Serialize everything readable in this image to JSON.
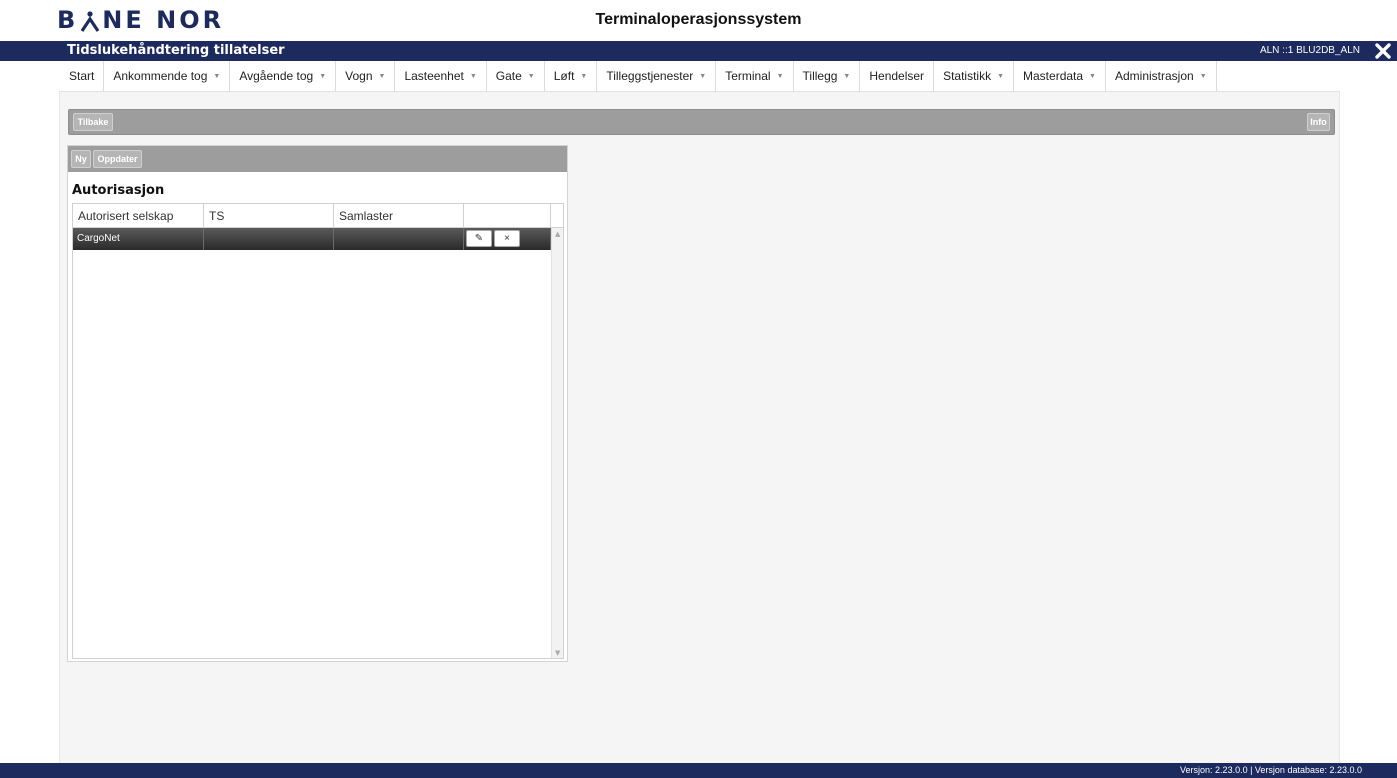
{
  "brand": {
    "logo_text_left": "B",
    "logo_text_right": "NE NOR",
    "logo_color": "#1c2a5e"
  },
  "app_title": "Terminaloperasjonssystem",
  "titlebar": {
    "title": "Tidslukehåndtering tillatelser",
    "user": "ALN ::1 BLU2DB_ALN",
    "close_icon": "close-icon"
  },
  "nav": {
    "items": [
      {
        "label": "Start",
        "dropdown": false
      },
      {
        "label": "Ankommende tog",
        "dropdown": true
      },
      {
        "label": "Avgående tog",
        "dropdown": true
      },
      {
        "label": "Vogn",
        "dropdown": true
      },
      {
        "label": "Lasteenhet",
        "dropdown": true
      },
      {
        "label": "Gate",
        "dropdown": true
      },
      {
        "label": "Løft",
        "dropdown": true
      },
      {
        "label": "Tilleggstjenester",
        "dropdown": true
      },
      {
        "label": "Terminal",
        "dropdown": true
      },
      {
        "label": "Tillegg",
        "dropdown": true
      },
      {
        "label": "Hendelser",
        "dropdown": false
      },
      {
        "label": "Statistikk",
        "dropdown": true
      },
      {
        "label": "Masterdata",
        "dropdown": true
      },
      {
        "label": "Administrasjon",
        "dropdown": true
      }
    ],
    "caret": "▼"
  },
  "toolbar": {
    "back_label": "Tilbake",
    "info_label": "Info"
  },
  "panel": {
    "new_label": "Ny",
    "refresh_label": "Oppdater",
    "heading": "Autorisasjon",
    "columns": [
      "Autorisert selskap",
      "TS",
      "Samlaster",
      ""
    ],
    "rows": [
      {
        "company": "CargoNet",
        "ts": "",
        "samlaster": "",
        "edit_icon": "pencil-icon",
        "delete_icon": "close-icon",
        "edit_glyph": "✎",
        "delete_glyph": "×"
      }
    ]
  },
  "footer": {
    "version": "Versjon:  2.23.0.0 | Versjon database:  2.23.0.0"
  },
  "colors": {
    "navy": "#1c2a5e",
    "toolbar_gray": "#9d9d9d",
    "row_dark": "#3a3a3a"
  }
}
